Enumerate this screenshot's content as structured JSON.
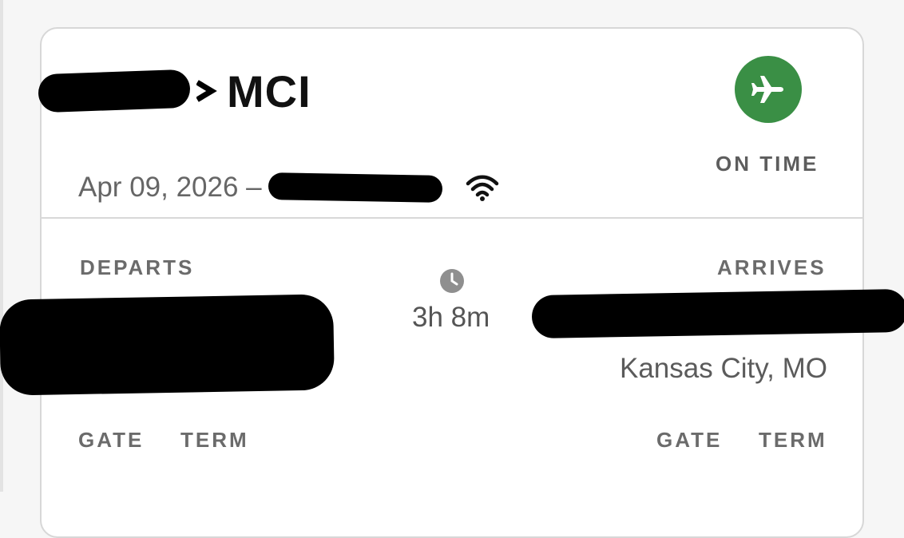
{
  "route": {
    "destination_code": "MCI",
    "origin_redacted": true
  },
  "status": {
    "label": "ON TIME",
    "color": "#3a8f45",
    "icon": "airplane-icon"
  },
  "flight": {
    "date": "Apr 09, 2026 –",
    "wifi_icon": "wifi-icon"
  },
  "departs": {
    "label": "DEPARTS",
    "gate_label": "GATE",
    "term_label": "TERM"
  },
  "arrives": {
    "label": "ARRIVES",
    "city": "Kansas City, MO",
    "gate_label": "GATE",
    "term_label": "TERM"
  },
  "duration": {
    "icon": "clock-icon",
    "value": "3h 8m"
  }
}
